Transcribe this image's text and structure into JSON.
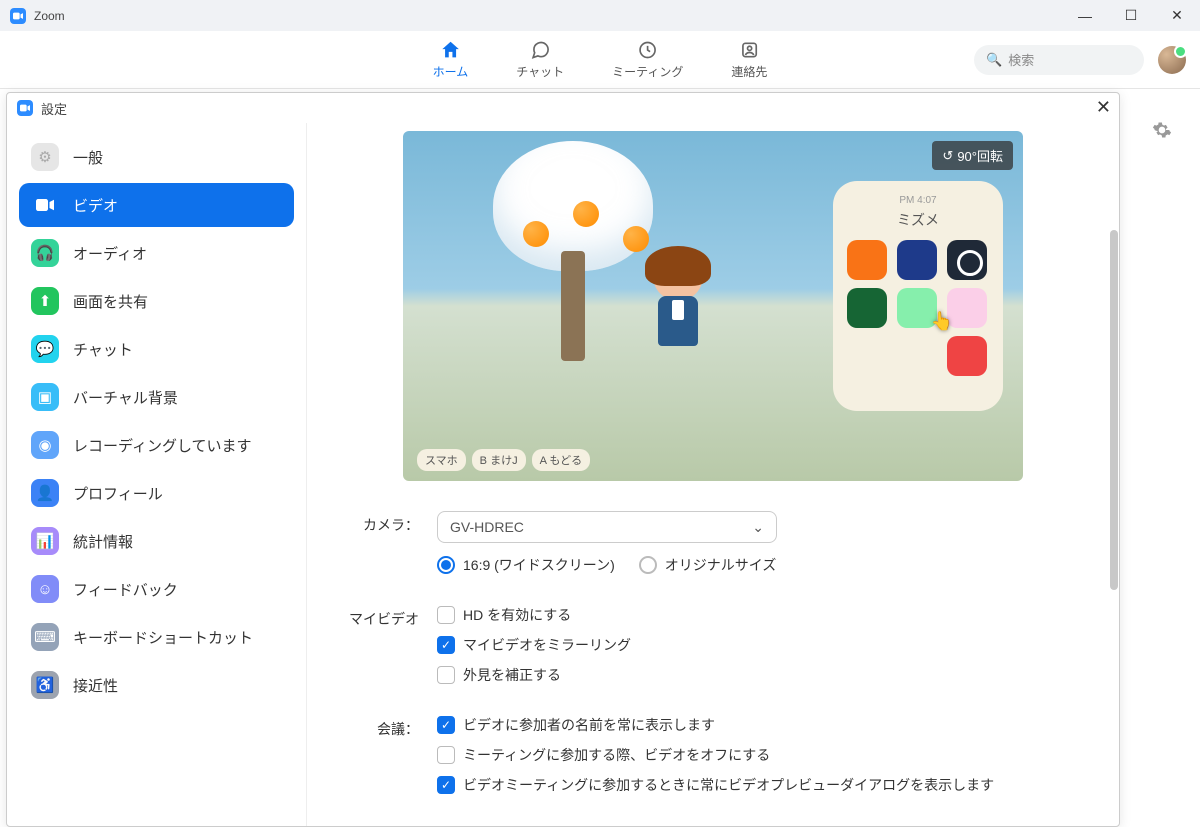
{
  "titlebar": {
    "app": "Zoom"
  },
  "nav": {
    "home": "ホーム",
    "chat": "チャット",
    "meetings": "ミーティング",
    "contacts": "連絡先",
    "search_placeholder": "検索"
  },
  "settings": {
    "title": "設定",
    "sidebar": {
      "general": "一般",
      "video": "ビデオ",
      "audio": "オーディオ",
      "share": "画面を共有",
      "chat": "チャット",
      "vbg": "バーチャル背景",
      "recording": "レコーディングしています",
      "profile": "プロフィール",
      "stats": "統計情報",
      "feedback": "フィードバック",
      "keyboard": "キーボードショートカット",
      "accessibility": "接近性"
    }
  },
  "preview": {
    "rotate": "90°回転",
    "phone_time": "PM 4:07",
    "phone_title": "ミズメ",
    "bottom_a": "A もどる",
    "bottom_b": "B まけJ",
    "bottom_c": "スマホ"
  },
  "video": {
    "camera_label": "カメラ：",
    "camera_value": "GV-HDREC",
    "aspect_169": "16:9 (ワイドスクリーン)",
    "aspect_orig": "オリジナルサイズ",
    "myvideo_label": "マイビデオ",
    "hd": "HD を有効にする",
    "mirror": "マイビデオをミラーリング",
    "touchup": "外見を補正する",
    "meeting_label": "会議：",
    "show_names": "ビデオに参加者の名前を常に表示します",
    "off_on_join": "ミーティングに参加する際、ビデオをオフにする",
    "preview_dialog": "ビデオミーティングに参加するときに常にビデオプレビューダイアログを表示します"
  }
}
